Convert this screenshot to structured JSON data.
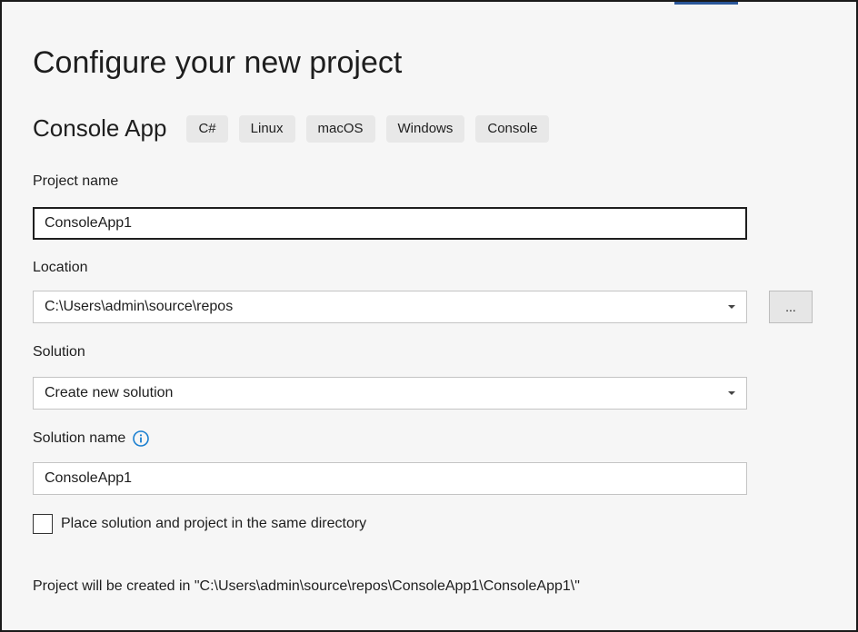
{
  "page": {
    "title": "Configure your new project"
  },
  "template": {
    "name": "Console App",
    "tags": [
      "C#",
      "Linux",
      "macOS",
      "Windows",
      "Console"
    ]
  },
  "project_name": {
    "label": "Project name",
    "value": "ConsoleApp1"
  },
  "location": {
    "label": "Location",
    "value": "C:\\Users\\admin\\source\\repos",
    "browse_label": "..."
  },
  "solution": {
    "label": "Solution",
    "value": "Create new solution"
  },
  "solution_name": {
    "label": "Solution name",
    "value": "ConsoleApp1",
    "info_icon": "info-icon"
  },
  "same_directory": {
    "label": "Place solution and project in the same directory",
    "checked": false
  },
  "footer": {
    "note": "Project will be created in \"C:\\Users\\admin\\source\\repos\\ConsoleApp1\\ConsoleApp1\\\""
  },
  "colors": {
    "background": "#f6f6f6",
    "tag_background": "#e8e8e8",
    "info_icon": "#1a7fd0",
    "accent": "#2b579a"
  }
}
